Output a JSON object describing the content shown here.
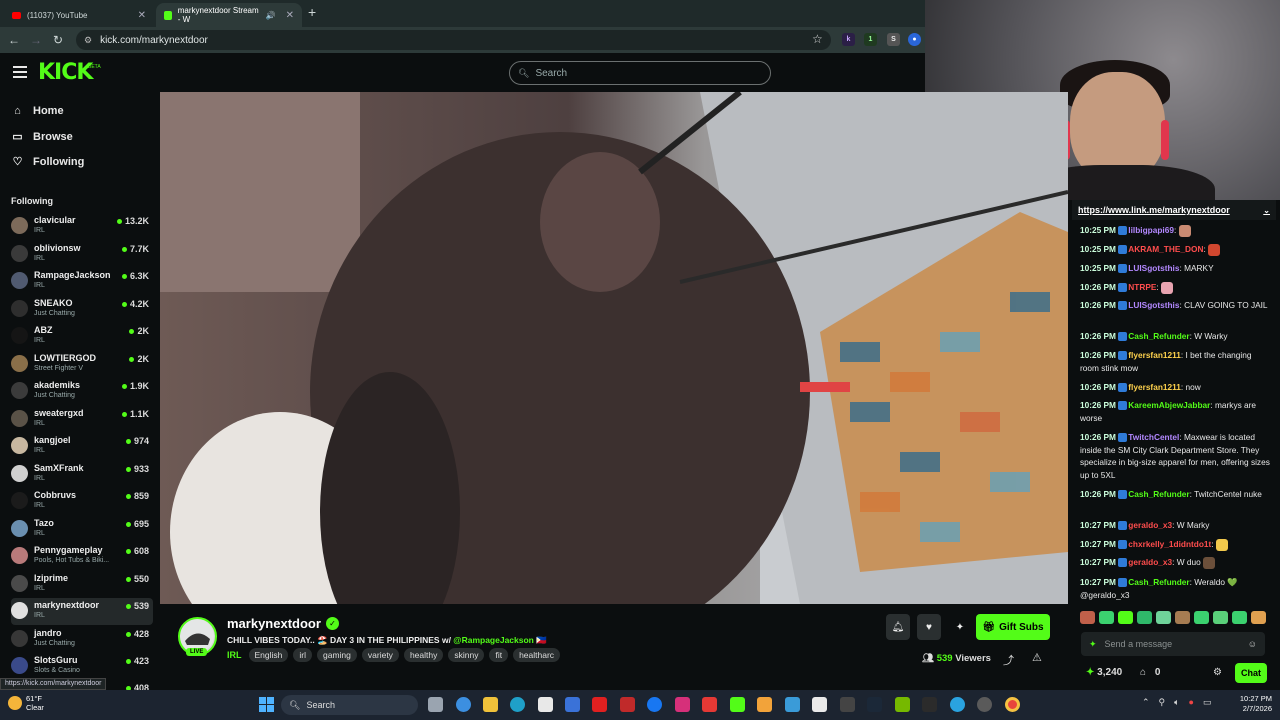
{
  "browser": {
    "tabs": [
      {
        "title": "(11037) YouTube",
        "active": false
      },
      {
        "title": "markynextdoor Stream - W",
        "active": true
      }
    ],
    "url": "kick.com/markynextdoor"
  },
  "header": {
    "logo": "KICK",
    "beta": "BETA",
    "search_placeholder": "Search"
  },
  "sidebar": {
    "nav": [
      {
        "label": "Home",
        "icon": "home-icon"
      },
      {
        "label": "Browse",
        "icon": "browse-icon"
      },
      {
        "label": "Following",
        "icon": "heart-icon"
      }
    ],
    "following_title": "Following",
    "channels": [
      {
        "name": "clavicular",
        "category": "IRL",
        "viewers": "13.2K",
        "color": "#7c6a5a"
      },
      {
        "name": "oblivionsw",
        "category": "IRL",
        "viewers": "7.7K",
        "color": "#3a3a3a"
      },
      {
        "name": "RampageJackson",
        "category": "IRL",
        "viewers": "6.3K",
        "color": "#505a70"
      },
      {
        "name": "SNEAKO",
        "category": "Just Chatting",
        "viewers": "4.2K",
        "color": "#2e2e2e"
      },
      {
        "name": "ABZ",
        "category": "IRL",
        "viewers": "2K",
        "color": "#151515"
      },
      {
        "name": "LOWTIERGOD",
        "category": "Street Fighter V",
        "viewers": "2K",
        "color": "#8a6f49"
      },
      {
        "name": "akademiks",
        "category": "Just Chatting",
        "viewers": "1.9K",
        "color": "#3b3b3b"
      },
      {
        "name": "sweatergxd",
        "category": "IRL",
        "viewers": "1.1K",
        "color": "#5a5247"
      },
      {
        "name": "kangjoel",
        "category": "IRL",
        "viewers": "974",
        "color": "#c7b7a0"
      },
      {
        "name": "SamXFrank",
        "category": "IRL",
        "viewers": "933",
        "color": "#d0d0d0"
      },
      {
        "name": "Cobbruvs",
        "category": "IRL",
        "viewers": "859",
        "color": "#1b1b1b"
      },
      {
        "name": "Tazo",
        "category": "IRL",
        "viewers": "695",
        "color": "#6a8fb0"
      },
      {
        "name": "Pennygameplay",
        "category": "Pools, Hot Tubs & Biki...",
        "viewers": "608",
        "color": "#b87a7a"
      },
      {
        "name": "lziprime",
        "category": "IRL",
        "viewers": "550",
        "color": "#4a4a4a"
      },
      {
        "name": "markynextdoor",
        "category": "IRL",
        "viewers": "539",
        "color": "#e0e0e0"
      },
      {
        "name": "jandro",
        "category": "Just Chatting",
        "viewers": "428",
        "color": "#373737"
      },
      {
        "name": "SlotsGuru",
        "category": "Slots & Casino",
        "viewers": "423",
        "color": "#3a4a8a"
      },
      {
        "name": "",
        "category": "",
        "viewers": "408",
        "color": "#555"
      }
    ],
    "status_url": "https://kick.com/markynextdoor"
  },
  "stream": {
    "name": "markynextdoor",
    "live": "LIVE",
    "title_prefix": "CHILL VIBES TODAY.. 🏖️ DAY 3 IN THE PHILIPPINES w/ ",
    "title_mention": "@RampageJackson",
    "title_suffix": " 🇵🇭",
    "category": "IRL",
    "tags": [
      "English",
      "irl",
      "gaming",
      "variety",
      "healthy",
      "skinny",
      "fit",
      "healtharc"
    ],
    "gift_subs_label": "Gift Subs",
    "viewers_count": "539",
    "viewers_label": "Viewers"
  },
  "chat": {
    "pinned_link": "https://www.link.me/markynextdoor",
    "messages": [
      {
        "time": "10:25 PM",
        "user": "lilbigpapi69",
        "color": "#b388ff",
        "text": "",
        "emote": "#c98a72"
      },
      {
        "time": "10:25 PM",
        "user": "AKRAM_THE_DON",
        "color": "#ff4d4d",
        "text": "",
        "emote": "#d2472f"
      },
      {
        "time": "10:25 PM",
        "user": "LUISgotsthis",
        "color": "#b388ff",
        "text": "MARKY",
        "emote": ""
      },
      {
        "time": "10:26 PM",
        "user": "NTRPE",
        "color": "#ff4d4d",
        "text": "",
        "emote": "#e8a3b0"
      },
      {
        "time": "10:26 PM",
        "user": "LUISgotsthis",
        "color": "#b388ff",
        "text": "CLAV GOING TO JAIL",
        "emote": ""
      },
      {
        "time": "10:26 PM",
        "user": "Cash_Refunder",
        "color": "#53fc18",
        "text": "W Warky",
        "emote": ""
      },
      {
        "time": "10:26 PM",
        "user": "flyersfan1211",
        "color": "#ffd24d",
        "text": "I bet the changing room stink mow",
        "emote": ""
      },
      {
        "time": "10:26 PM",
        "user": "flyersfan1211",
        "color": "#ffd24d",
        "text": "now",
        "emote": ""
      },
      {
        "time": "10:26 PM",
        "user": "KareemAbjewJabbar",
        "color": "#53fc18",
        "text": "markys are worse",
        "emote": ""
      },
      {
        "time": "10:26 PM",
        "user": "TwitchCentel",
        "color": "#b388ff",
        "text": "Maxwear is located inside the SM City Clark Department Store. They specialize in big-size apparel for men, offering sizes up to 5XL",
        "emote": ""
      },
      {
        "time": "10:26 PM",
        "user": "Cash_Refunder",
        "color": "#53fc18",
        "text": "TwitchCentel nuke",
        "emote": ""
      },
      {
        "time": "10:27 PM",
        "user": "geraldo_x3",
        "color": "#ff4d4d",
        "text": "W Marky",
        "emote": ""
      },
      {
        "time": "10:27 PM",
        "user": "chxrkelly_1didntdo1t",
        "color": "#ff4d4d",
        "text": "",
        "emote": "#f2c94c"
      },
      {
        "time": "10:27 PM",
        "user": "geraldo_x3",
        "color": "#ff4d4d",
        "text": "W duo",
        "emote": "#6b4f3a"
      },
      {
        "time": "10:27 PM",
        "user": "Cash_Refunder",
        "color": "#53fc18",
        "text": "Weraldo 💚 @geraldo_x3",
        "emote": ""
      }
    ],
    "input_placeholder": "Send a message",
    "points": "3,240",
    "subs_count": "0",
    "chat_button": "Chat"
  },
  "taskbar": {
    "temperature": "61°F",
    "weather": "Clear",
    "search": "Search",
    "time": "10:27 PM",
    "date": "2/7/2026"
  }
}
